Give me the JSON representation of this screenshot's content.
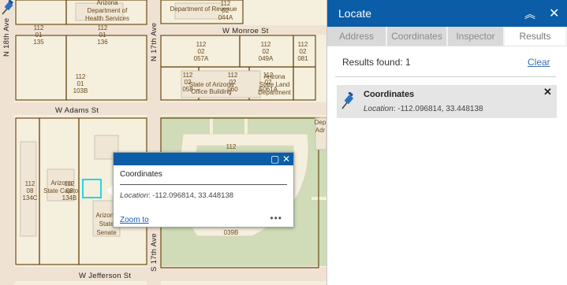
{
  "map": {
    "parcels": [
      {
        "lines": [
          "112",
          "01",
          "135"
        ]
      },
      {
        "lines": [
          "112",
          "01",
          "136"
        ]
      },
      {
        "lines": [
          "112",
          "02",
          "057A"
        ]
      },
      {
        "lines": [
          "112",
          "02",
          "049A"
        ]
      },
      {
        "lines": [
          "112",
          "02",
          "081"
        ]
      },
      {
        "lines": [
          "112",
          "01",
          "103B"
        ]
      },
      {
        "lines": [
          "112",
          "02",
          "058"
        ]
      },
      {
        "lines": [
          "112",
          "02",
          "060"
        ]
      },
      {
        "lines": [
          "112",
          "02",
          "S061A"
        ]
      },
      {
        "lines": [
          "112",
          "08",
          "134C"
        ]
      },
      {
        "lines": [
          "112",
          "08",
          "134B"
        ]
      },
      {
        "lines": [
          "112"
        ]
      },
      {
        "lines": [
          "039B"
        ]
      },
      {
        "lines": [
          "112",
          "02",
          "044A"
        ]
      }
    ],
    "buildings": [
      {
        "lines": [
          "Arizona",
          "Department of",
          "Health Services"
        ]
      },
      {
        "lines": [
          "Department of Revenue"
        ]
      },
      {
        "lines": [
          "State of Arizona",
          "Office Building"
        ]
      },
      {
        "lines": [
          "Arizona",
          "State Land",
          "Department"
        ]
      },
      {
        "lines": [
          "Dep",
          "Adr"
        ]
      },
      {
        "lines": [
          "Arizona",
          "State Capitol"
        ]
      },
      {
        "lines": [
          "Arizona",
          "State",
          "Senate"
        ]
      }
    ],
    "streets": {
      "monroe": "W Monroe St",
      "adams": "W Adams St",
      "jefferson": "W Jefferson St",
      "ave18": "N 18th Ave",
      "ave17": "N 17th Ave",
      "ave17s": "S 17th Ave"
    }
  },
  "popup": {
    "title": "Coordinates",
    "location_label": "Location",
    "location_value": ": -112.096814, 33.448138",
    "zoom_link": "Zoom to",
    "maximize_icon": "maximize-icon",
    "close_icon": "close-icon",
    "more_icon": "more-icon"
  },
  "panel": {
    "title": "Locate",
    "collapse_icon": "double-chevron-up-icon",
    "close_icon": "close-icon",
    "tabs": [
      {
        "label": "Address",
        "active": false
      },
      {
        "label": "Coordinates",
        "active": false
      },
      {
        "label": "Inspector",
        "active": false
      },
      {
        "label": "Results",
        "active": true
      }
    ],
    "results_found": "Results found: 1",
    "clear_label": "Clear",
    "result": {
      "title": "Coordinates",
      "location_label": "Location",
      "location_value": ": -112.096814, 33.448138",
      "icon": "pushpin-icon"
    }
  },
  "colors": {
    "header": "#0a5da6",
    "parcel_line": "#6b4a14",
    "street": "#f2e6d6",
    "green": "#cddcb6",
    "highlight": "#25d6e6"
  }
}
